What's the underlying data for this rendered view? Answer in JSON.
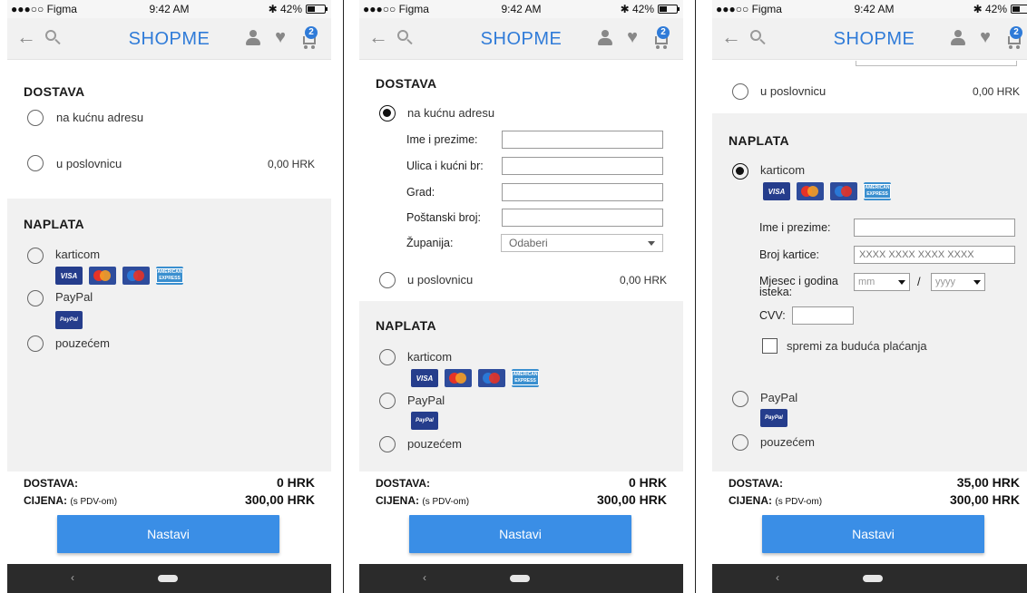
{
  "status": {
    "carrier": "●●●○○ Figma",
    "time": "9:42 AM",
    "battery": "✱ 42%"
  },
  "nav": {
    "logo_prefix": "SHOP",
    "logo_suffix": "ME",
    "cart_count": "2"
  },
  "colors": {
    "accent": "#2f7bd8",
    "button": "#3a8ee6",
    "grey_section": "#f1f1f1"
  },
  "labels": {
    "dostava": "DOSTAVA",
    "naplata": "NAPLATA",
    "home_address": "na kućnu adresu",
    "branch": "u poslovnicu",
    "branch_price": "0,00 HRK",
    "card": "karticom",
    "paypal": "PayPal",
    "cod": "pouzećem",
    "visa": "VISA",
    "paypal_logo": "PayPal",
    "amex": "AMERICAN EXPRESS"
  },
  "address_form": {
    "name": "Ime i prezime:",
    "street": "Ulica i kućni br:",
    "city": "Grad:",
    "postal": "Poštanski broj:",
    "county": "Županija:",
    "county_value": "Odaberi"
  },
  "card_form": {
    "name": "Ime i prezime:",
    "number": "Broj kartice:",
    "number_placeholder": "XXXX XXXX XXXX XXXX",
    "expiry_line1": "Mjesec i godina",
    "expiry_line2": "isteka:",
    "month": "mm",
    "year": "yyyy",
    "slash": "/",
    "cvv": "CVV:",
    "save": "spremi za buduća plaćanja"
  },
  "screens": [
    {
      "summary": {
        "dostava_label": "DOSTAVA:",
        "dostava_value": "0 HRK",
        "cijena_label": "CIJENA:",
        "cijena_note": "(s PDV-om)",
        "cijena_value": "300,00 HRK"
      }
    },
    {
      "summary": {
        "dostava_label": "DOSTAVA:",
        "dostava_value": "0 HRK",
        "cijena_label": "CIJENA:",
        "cijena_note": "(s PDV-om)",
        "cijena_value": "300,00 HRK"
      }
    },
    {
      "summary": {
        "dostava_label": "DOSTAVA:",
        "dostava_value": "35,00 HRK",
        "cijena_label": "CIJENA:",
        "cijena_note": "(s PDV-om)",
        "cijena_value": "300,00 HRK"
      }
    }
  ],
  "button": {
    "continue": "Nastavi"
  },
  "sys": {
    "back": "‹"
  }
}
